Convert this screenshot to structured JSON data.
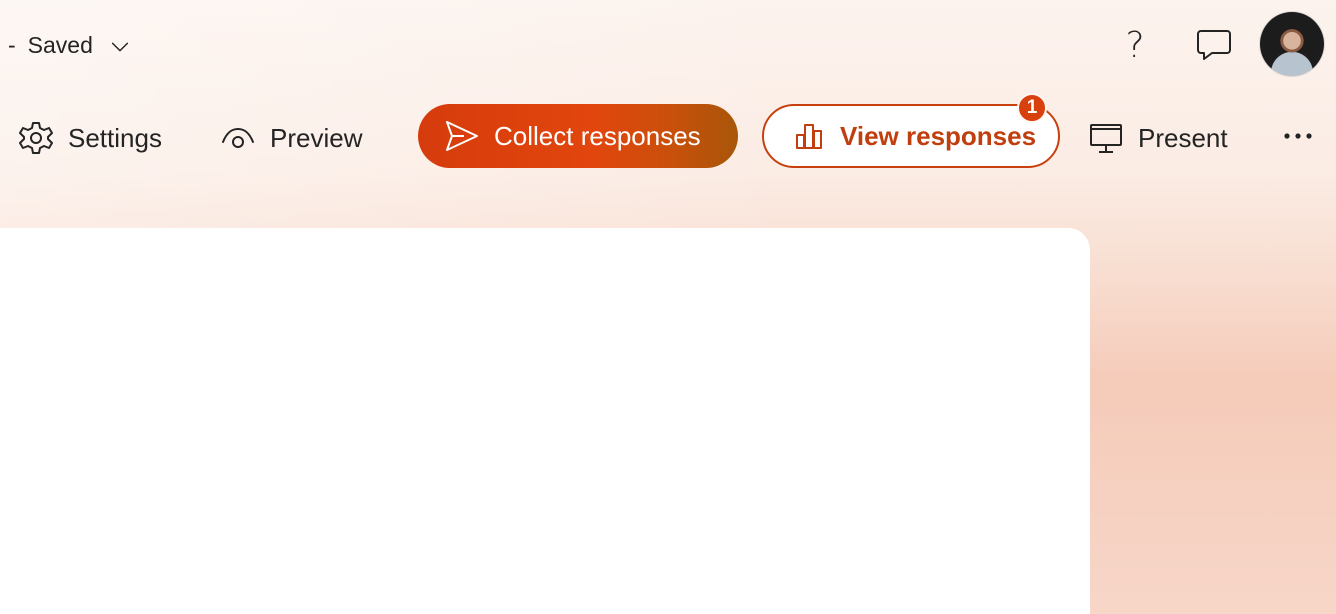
{
  "header": {
    "separator": "-",
    "save_status": "Saved",
    "help_glyph": "?"
  },
  "toolbar": {
    "settings_label": "Settings",
    "preview_label": "Preview",
    "collect_label": "Collect responses",
    "view_label": "View responses",
    "view_badge_count": "1",
    "present_label": "Present"
  },
  "icons": {
    "saved_chevron": "chevron-down-icon",
    "help": "question-icon",
    "feedback": "chat-bubble-icon",
    "settings": "gear-icon",
    "preview": "eye-icon",
    "collect": "send-icon",
    "view": "bar-chart-icon",
    "present": "monitor-icon",
    "more": "more-horizontal-icon"
  },
  "colors": {
    "accent": "#d63b0c",
    "accent_text": "#c13e0e",
    "badge": "#d8400e",
    "card": "#ffffff",
    "background": "#f8ddd0"
  }
}
